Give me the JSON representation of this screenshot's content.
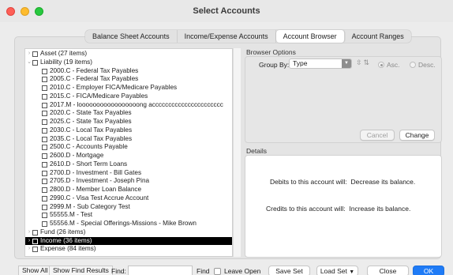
{
  "window": {
    "title": "Select Accounts"
  },
  "tabs": [
    {
      "label": "Balance Sheet Accounts"
    },
    {
      "label": "Income/Expense Accounts"
    },
    {
      "label": "Account Browser"
    },
    {
      "label": "Account Ranges"
    }
  ],
  "tree": {
    "rows": [
      {
        "label": "Asset (27 items)",
        "level": 0,
        "chevron": "›",
        "selected": false
      },
      {
        "label": "Liability (19 items)",
        "level": 0,
        "chevron": "⌄",
        "selected": false
      },
      {
        "label": "2000.C - Federal Tax Payables",
        "level": 1,
        "chevron": "",
        "selected": false
      },
      {
        "label": "2005.C - Federal Tax Payables",
        "level": 1,
        "chevron": "",
        "selected": false
      },
      {
        "label": "2010.C - Employer FICA/Medicare Payables",
        "level": 1,
        "chevron": "",
        "selected": false
      },
      {
        "label": "2015.C - FICA/Medicare Payables",
        "level": 1,
        "chevron": "",
        "selected": false
      },
      {
        "label": "2017.M - looooooooooooooooong acccccccccccccccccccccc",
        "level": 1,
        "chevron": "",
        "selected": false
      },
      {
        "label": "2020.C - State Tax Payables",
        "level": 1,
        "chevron": "",
        "selected": false
      },
      {
        "label": "2025.C - State Tax Payables",
        "level": 1,
        "chevron": "",
        "selected": false
      },
      {
        "label": "2030.C - Local Tax Payables",
        "level": 1,
        "chevron": "",
        "selected": false
      },
      {
        "label": "2035.C - Local Tax Payables",
        "level": 1,
        "chevron": "",
        "selected": false
      },
      {
        "label": "2500.C - Accounts Payable",
        "level": 1,
        "chevron": "",
        "selected": false
      },
      {
        "label": "2600.D - Mortgage",
        "level": 1,
        "chevron": "",
        "selected": false
      },
      {
        "label": "2610.D - Short Term Loans",
        "level": 1,
        "chevron": "",
        "selected": false
      },
      {
        "label": "2700.D - Investment - Bill Gates",
        "level": 1,
        "chevron": "",
        "selected": false
      },
      {
        "label": "2705.D - Investment - Joseph Pina",
        "level": 1,
        "chevron": "",
        "selected": false
      },
      {
        "label": "2800.D - Member Loan Balance",
        "level": 1,
        "chevron": "",
        "selected": false
      },
      {
        "label": "2990.C - Visa Test Accrue Account",
        "level": 1,
        "chevron": "",
        "selected": false
      },
      {
        "label": "2999.M - Sub Category Test",
        "level": 1,
        "chevron": "",
        "selected": false
      },
      {
        "label": "55555.M - Test",
        "level": 1,
        "chevron": "",
        "selected": false
      },
      {
        "label": "55556.M - Special Offerings-Missions - Mike Brown",
        "level": 1,
        "chevron": "",
        "selected": false
      },
      {
        "label": "Fund (26 items)",
        "level": 0,
        "chevron": "›",
        "selected": false
      },
      {
        "label": "Income (36 items)",
        "level": 0,
        "chevron": "›",
        "selected": true
      },
      {
        "label": "Expense (84 items)",
        "level": 0,
        "chevron": "›",
        "selected": false
      }
    ]
  },
  "browser_options": {
    "section_label": "Browser Options",
    "group_by_label": "Group By:",
    "group_by_value": "Type",
    "asc_label": "Asc.",
    "desc_label": "Desc.",
    "cancel_label": "Cancel",
    "change_label": "Change"
  },
  "details": {
    "section_label": "Details",
    "debits_label": "Debits to this account will:",
    "debits_value": "Decrease its balance.",
    "credits_label": "Credits to this account will:",
    "credits_value": "Increase its balance."
  },
  "bottom": {
    "show_all": "Show All",
    "show_find_results": "Show Find Results",
    "find_label": "Find:",
    "find_value": "",
    "find_button": "Find",
    "leave_open": "Leave Open",
    "save_set": "Save Set",
    "load_set": "Load Set",
    "load_set_arrow": "▼",
    "close": "Close",
    "ok": "OK"
  }
}
